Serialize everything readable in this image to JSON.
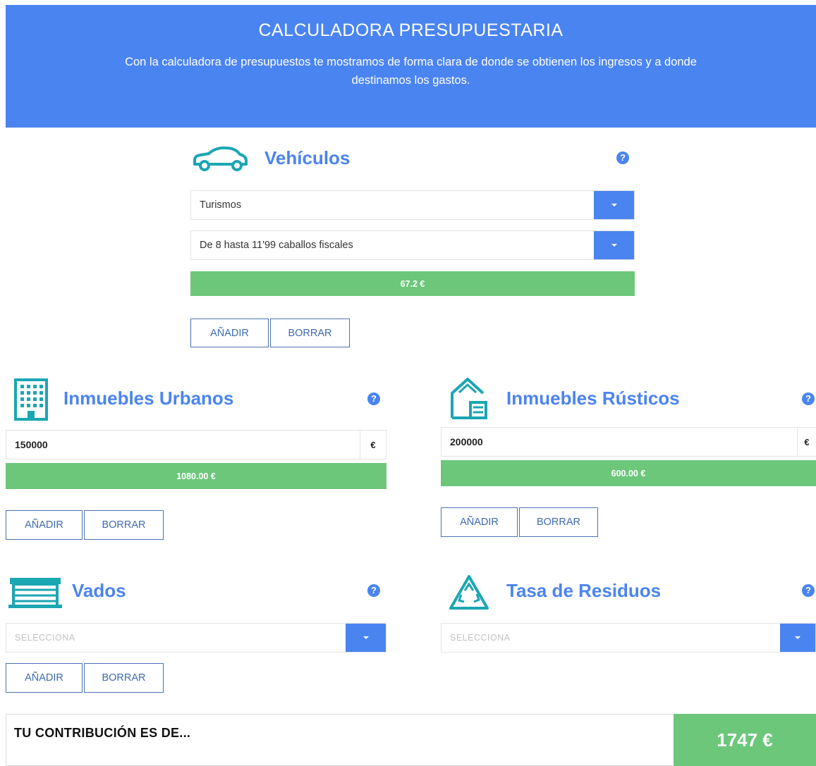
{
  "colors": {
    "blue": "#4a84f1",
    "green": "#6cc77b",
    "icon": "#1ba6b3"
  },
  "header": {
    "title": "CALCULADORA PRESUPUESTARIA",
    "subtitle": "Con la calculadora de presupuestos te mostramos de forma clara de donde se obtienen los ingresos y a donde destinamos los gastos."
  },
  "vehiculos": {
    "title": "Vehículos",
    "icon": "car-icon",
    "help": "?",
    "select1": "Turismos",
    "select2": "De 8 hasta 11'99 caballos fiscales",
    "result": "67.2 €",
    "add_label": "AÑADIR",
    "clear_label": "BORRAR"
  },
  "urbanos": {
    "title": "Inmuebles Urbanos",
    "icon": "building-icon",
    "help": "?",
    "value": "150000",
    "currency": "€",
    "result": "1080.00 €",
    "add_label": "AÑADIR",
    "clear_label": "BORRAR"
  },
  "rusticos": {
    "title": "Inmuebles Rústicos",
    "icon": "house-icon",
    "help": "?",
    "value": "200000",
    "currency": "€",
    "result": "600.00 €",
    "add_label": "AÑADIR",
    "clear_label": "BORRAR"
  },
  "vados": {
    "title": "Vados",
    "icon": "garage-icon",
    "help": "?",
    "placeholder": "SELECCIONA",
    "add_label": "AÑADIR",
    "clear_label": "BORRAR"
  },
  "residuos": {
    "title": "Tasa de Residuos",
    "icon": "recycle-icon",
    "help": "?",
    "placeholder": "SELECCIONA"
  },
  "total": {
    "label": "TU CONTRIBUCIÓN ES DE...",
    "value": "1747 €"
  }
}
